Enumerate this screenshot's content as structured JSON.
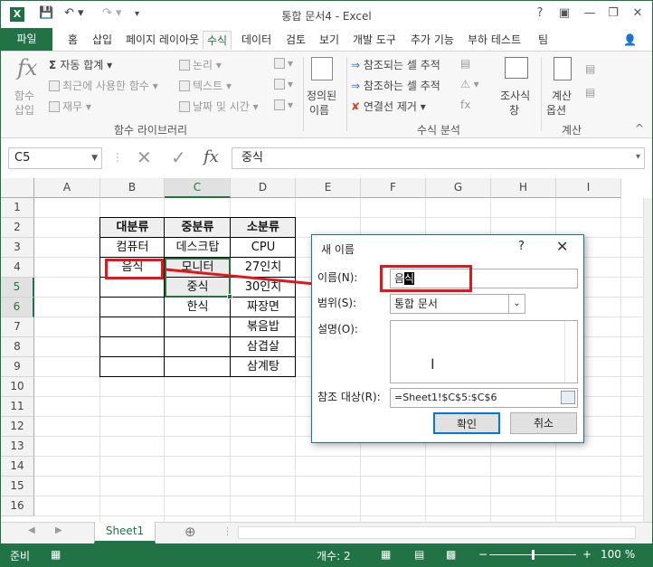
{
  "window": {
    "app_icon": "X",
    "title": "통합 문서4 - Excel",
    "help": "?",
    "user_icon": "person-icon"
  },
  "ribbon_tabs": [
    "파일",
    "홈",
    "삽입",
    "페이지 레이아웃",
    "수식",
    "데이터",
    "검토",
    "보기",
    "개발 도구",
    "추가 기능",
    "부하 테스트",
    "팀"
  ],
  "active_tab": "수식",
  "ribbon": {
    "insert_function": [
      "함수",
      "삽입"
    ],
    "autosum": "자동 합계",
    "recent": "최근에 사용한 함수",
    "financial": "재무",
    "logical": "논리",
    "text": "텍스트",
    "datetime": "날짜 및 시간",
    "group_library": "함수 라이브러리",
    "define_name": [
      "정의된",
      "이름"
    ],
    "trace_precedents": "참조되는 셀 추적",
    "trace_dependents": "참조하는 셀 추적",
    "remove_arrows": "연결선 제거",
    "group_audit": "수식 분석",
    "watch": [
      "조사식",
      "창"
    ],
    "calc_options": [
      "계산",
      "옵션"
    ],
    "group_calc": "계산"
  },
  "formula_bar": {
    "name_box": "C5",
    "fx": "fx",
    "content": "중식"
  },
  "columns": [
    "A",
    "B",
    "C",
    "D",
    "E",
    "F",
    "G",
    "H",
    "I"
  ],
  "selected_column": "C",
  "rows": [
    "1",
    "2",
    "3",
    "4",
    "5",
    "6",
    "7",
    "8",
    "9",
    "10",
    "11",
    "12",
    "13",
    "14",
    "15",
    "16"
  ],
  "selected_rows": [
    "5",
    "6"
  ],
  "table": {
    "headers": [
      "대분류",
      "중분류",
      "소분류"
    ],
    "col_b": [
      "컴퓨터",
      "음식",
      "",
      "",
      "",
      ""
    ],
    "col_c": [
      "데스크탑",
      "모니터",
      "중식",
      "한식",
      "",
      ""
    ],
    "col_d": [
      "CPU",
      "27인치",
      "30인치",
      "짜장면",
      "볶음밥",
      "삼겹살",
      "삼계탕"
    ]
  },
  "sheet_tabs": [
    "Sheet1"
  ],
  "add_sheet": "⊕",
  "status": {
    "ready": "준비",
    "count": "개수: 2",
    "zoom": "100 %"
  },
  "dialog": {
    "title": "새 이름",
    "help": "?",
    "name_label": "이름(N):",
    "name_value_plain": "음",
    "name_value_selected": "식",
    "scope_label": "범위(S):",
    "scope_value": "통합 문서",
    "comment_label": "설명(O):",
    "refers_label": "참조 대상(R):",
    "refers_value": "=Sheet1!$C$5:$C$6",
    "ok": "확인",
    "cancel": "취소"
  }
}
